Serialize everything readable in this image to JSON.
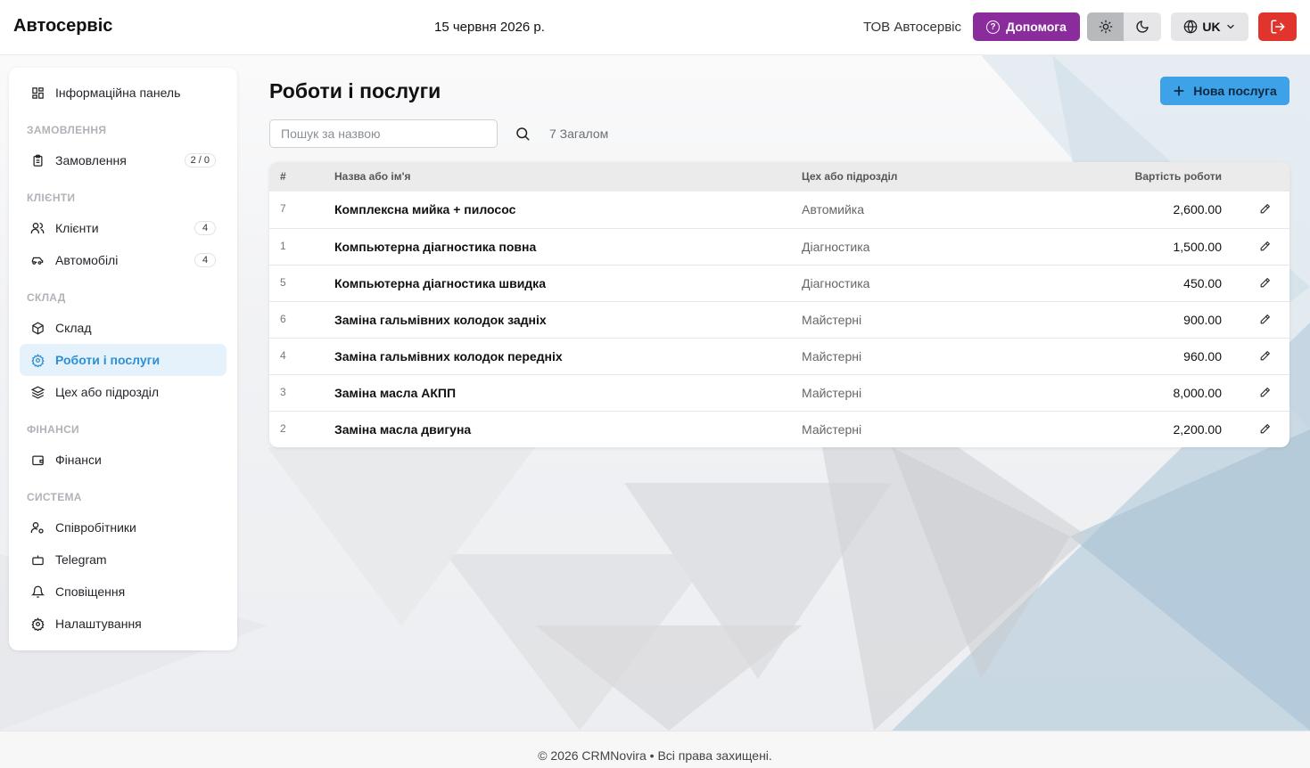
{
  "header": {
    "brand": "Автосервіс",
    "date": "15 червня 2026 р.",
    "company": "ТОВ Автосервіс",
    "help_label": "Допомога",
    "lang_label": "UK",
    "colors": {
      "help": "#8b2c9c",
      "logout": "#e0342c",
      "primary": "#3da2e8"
    }
  },
  "sidebar": {
    "items": [
      {
        "label": "Інформаційна панель",
        "icon": "dashboard-icon"
      },
      {
        "section": "ЗАМОВЛЕННЯ"
      },
      {
        "label": "Замовлення",
        "icon": "clipboard-icon",
        "badge": "2 / 0"
      },
      {
        "section": "КЛІЄНТИ"
      },
      {
        "label": "Клієнти",
        "icon": "users-icon",
        "badge": "4"
      },
      {
        "label": "Автомобілі",
        "icon": "car-icon",
        "badge": "4"
      },
      {
        "section": "СКЛАД"
      },
      {
        "label": "Склад",
        "icon": "box-icon"
      },
      {
        "label": "Роботи і послуги",
        "icon": "gear-icon",
        "active": true
      },
      {
        "label": "Цех або підрозділ",
        "icon": "layers-icon"
      },
      {
        "section": "ФІНАНСИ"
      },
      {
        "label": "Фінанси",
        "icon": "wallet-icon"
      },
      {
        "section": "СИСТЕМА"
      },
      {
        "label": "Співробітники",
        "icon": "user-gear-icon"
      },
      {
        "label": "Telegram",
        "icon": "bot-icon"
      },
      {
        "label": "Сповіщення",
        "icon": "bell-icon"
      },
      {
        "label": "Налаштування",
        "icon": "settings-icon"
      }
    ]
  },
  "main": {
    "title": "Роботи і послуги",
    "new_button": "Нова послуга",
    "search_placeholder": "Пошук за назвою",
    "total": "7 Загалом",
    "columns": [
      "#",
      "Назва або ім'я",
      "Цех або підрозділ",
      "Вартість роботи"
    ],
    "rows": [
      {
        "id": "7",
        "name": "Комплексна мийка + пилосос",
        "dept": "Автомийка",
        "cost": "2,600.00"
      },
      {
        "id": "1",
        "name": "Компьютерна діагностика повна",
        "dept": "Діагностика",
        "cost": "1,500.00"
      },
      {
        "id": "5",
        "name": "Компьютерна діагностика швидка",
        "dept": "Діагностика",
        "cost": "450.00"
      },
      {
        "id": "6",
        "name": "Заміна гальмівних колодок задніх",
        "dept": "Майстерні",
        "cost": "900.00"
      },
      {
        "id": "4",
        "name": "Заміна гальмівних колодок передніх",
        "dept": "Майстерні",
        "cost": "960.00"
      },
      {
        "id": "3",
        "name": "Заміна масла АКПП",
        "dept": "Майстерні",
        "cost": "8,000.00"
      },
      {
        "id": "2",
        "name": "Заміна масла двигуна",
        "dept": "Майстерні",
        "cost": "2,200.00"
      }
    ]
  },
  "footer": {
    "text": "© 2026 CRMNovira • Всі права захищені."
  }
}
